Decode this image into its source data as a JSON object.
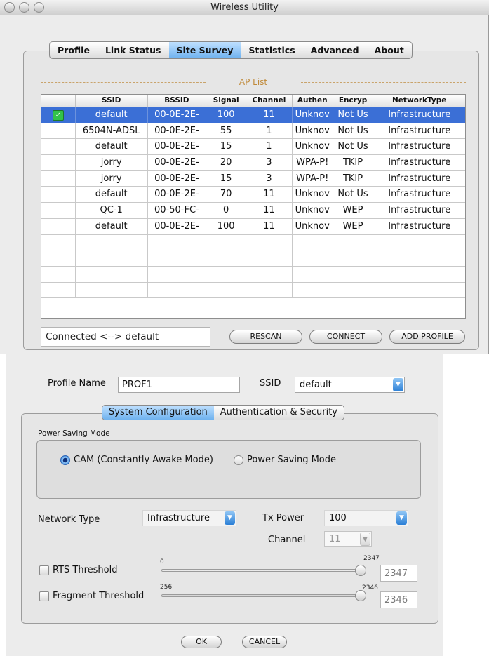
{
  "window": {
    "title": "Wireless Utility"
  },
  "main_tabs": [
    {
      "label": "Profile",
      "selected": false
    },
    {
      "label": "Link Status",
      "selected": false
    },
    {
      "label": "Site Survey",
      "selected": true
    },
    {
      "label": "Statistics",
      "selected": false
    },
    {
      "label": "Advanced",
      "selected": false
    },
    {
      "label": "About",
      "selected": false
    }
  ],
  "ap_list": {
    "title": "AP List",
    "columns": [
      "",
      "SSID",
      "BSSID",
      "Signal",
      "Channel",
      "Authen",
      "Encryp",
      "NetworkType"
    ],
    "rows": [
      {
        "ssid": "default",
        "bssid": "00-0E-2E-",
        "signal": "100",
        "channel": "11",
        "authen": "Unknov",
        "encryp": "Not Us",
        "network_type": "Infrastructure",
        "selected": true,
        "connected_icon": true
      },
      {
        "ssid": "6504N-ADSL",
        "bssid": "00-0E-2E-",
        "signal": "55",
        "channel": "1",
        "authen": "Unknov",
        "encryp": "Not Us",
        "network_type": "Infrastructure"
      },
      {
        "ssid": "default",
        "bssid": "00-0E-2E-",
        "signal": "15",
        "channel": "1",
        "authen": "Unknov",
        "encryp": "Not Us",
        "network_type": "Infrastructure"
      },
      {
        "ssid": "jorry",
        "bssid": "00-0E-2E-",
        "signal": "20",
        "channel": "3",
        "authen": "WPA-P!",
        "encryp": "TKIP",
        "network_type": "Infrastructure"
      },
      {
        "ssid": "jorry",
        "bssid": "00-0E-2E-",
        "signal": "15",
        "channel": "3",
        "authen": "WPA-P!",
        "encryp": "TKIP",
        "network_type": "Infrastructure"
      },
      {
        "ssid": "default",
        "bssid": "00-0E-2E-",
        "signal": "70",
        "channel": "11",
        "authen": "Unknov",
        "encryp": "Not Us",
        "network_type": "Infrastructure"
      },
      {
        "ssid": "QC-1",
        "bssid": "00-50-FC-",
        "signal": "0",
        "channel": "11",
        "authen": "Unknov",
        "encryp": "WEP",
        "network_type": "Infrastructure"
      },
      {
        "ssid": "default",
        "bssid": "00-0E-2E-",
        "signal": "100",
        "channel": "11",
        "authen": "Unknov",
        "encryp": "WEP",
        "network_type": "Infrastructure"
      }
    ],
    "empty_rows": 4
  },
  "status": {
    "connection_text": "Connected <--> default"
  },
  "buttons": {
    "rescan": "RESCAN",
    "connect": "CONNECT",
    "add_profile": "ADD PROFILE"
  },
  "profile": {
    "name_label": "Profile Name",
    "name_value": "PROF1",
    "ssid_label": "SSID",
    "ssid_value": "default"
  },
  "sub_tabs": [
    {
      "label": "System Configuration",
      "selected": true
    },
    {
      "label": "Authentication & Security",
      "selected": false
    }
  ],
  "power_saving": {
    "group_label": "Power Saving Mode",
    "options": [
      {
        "label": "CAM (Constantly Awake Mode)",
        "checked": true
      },
      {
        "label": "Power Saving Mode",
        "checked": false
      }
    ]
  },
  "network_type": {
    "label": "Network Type",
    "value": "Infrastructure"
  },
  "tx_power": {
    "label": "Tx Power",
    "value": "100"
  },
  "channel": {
    "label": "Channel",
    "value": "11"
  },
  "rts": {
    "label": "RTS Threshold",
    "checked": false,
    "min": "0",
    "max": "2347",
    "value": "2347",
    "fraction": 1.0
  },
  "fragment": {
    "label": "Fragment Threshold",
    "checked": false,
    "min": "256",
    "max": "2346",
    "value": "2346",
    "fraction": 1.0
  },
  "dialog_buttons": {
    "ok": "OK",
    "cancel": "CANCEL"
  }
}
